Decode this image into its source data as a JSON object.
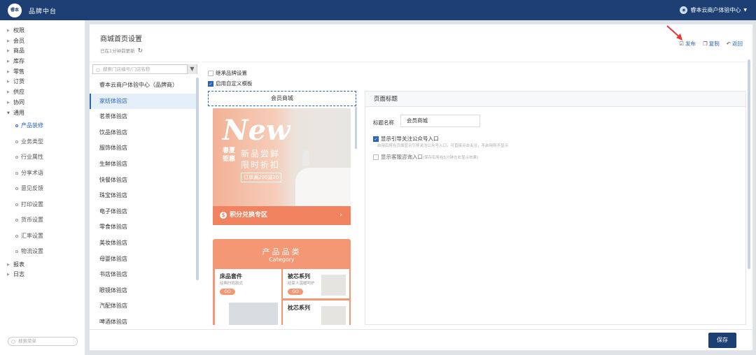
{
  "header": {
    "logo_text": "睿本",
    "app_title": "品牌中台",
    "store_name": "睿本云商户体验中心"
  },
  "sidebar": {
    "items_top": [
      "权限",
      "会员",
      "商品",
      "库存",
      "零售",
      "订货",
      "供应",
      "协同",
      "通用"
    ],
    "subitems": [
      "产品装修",
      "业务类型",
      "行业属性",
      "分享术语",
      "意见反馈",
      "打印设置",
      "货币设置",
      "汇率设置",
      "物流设置"
    ],
    "items_bottom": [
      "报表",
      "日志"
    ],
    "search_placeholder": "搜索菜单"
  },
  "page": {
    "title": "商城首页设置",
    "updated": "已在1分钟前更新",
    "publish": "发布",
    "copy": "复制",
    "back": "返回"
  },
  "stores": {
    "search_placeholder": "搜索门店编号/门店名称",
    "list": [
      "睿本云商户体验中心（品牌商）",
      "家纺体验店",
      "茗茶体验店",
      "饮品体验店",
      "服饰体验店",
      "生鲜体验店",
      "快餐体验店",
      "珠宝体验店",
      "电子体验店",
      "零食体验店",
      "美妆体验店",
      "母婴体验店",
      "书店体验店",
      "眼镜体验店",
      "汽配体验店",
      "啤酒体验店"
    ]
  },
  "settings": {
    "inherit_brand": "继承品牌设置",
    "custom_template": "启用自定义模板",
    "phone_header": "会员商城",
    "banner_new": "New",
    "banner_promo": "春夏钜惠",
    "banner_slogan_1": "新品尝鲜",
    "banner_slogan_2": "限时折扣",
    "banner_coupon": "订单满200减20",
    "points_label": "积分兑换专区",
    "category_title": "产品品类",
    "category_sub": "Category",
    "card1_name": "床品套件",
    "card1_desc": "经典时尚款式",
    "card2_name": "被芯系列",
    "card2_desc": "给家人温暖呵护",
    "card3_name": "枕芯系列",
    "go_label": "GO"
  },
  "right": {
    "header": "页面标题",
    "label": "标题名称",
    "value": "会员商城",
    "opt1": "显示引导关注公众号入口",
    "hint": "启用后将在页面显示引导关注公众号入口，可直接点击关注，不启用则不显示",
    "opt2": "显示客服咨询入口",
    "opt2_note": "(保存后将在5分钟左右显示效果)"
  },
  "footer": {
    "save": "保存"
  }
}
